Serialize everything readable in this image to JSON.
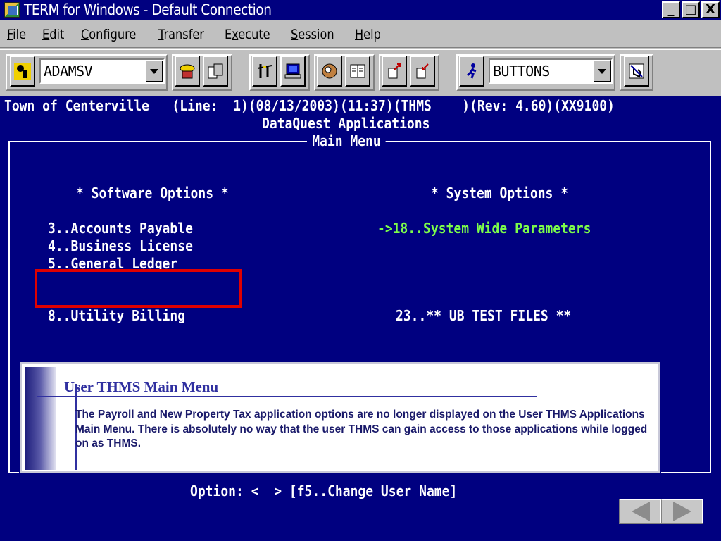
{
  "window": {
    "title": "TERM for Windows - Default Connection",
    "minimize": "_",
    "maximize": "□",
    "close": "X"
  },
  "menu": {
    "items": [
      {
        "first": "F",
        "rest": "ile"
      },
      {
        "first": "E",
        "rest": "dit"
      },
      {
        "first": "C",
        "rest": "onfigure"
      },
      {
        "first": "T",
        "rest": "ransfer"
      },
      {
        "pre": "E",
        "first": "x",
        "rest": "ecute"
      },
      {
        "first": "S",
        "rest": "ession"
      },
      {
        "first": "H",
        "rest": "elp"
      }
    ]
  },
  "toolbar": {
    "connection_value": "ADAMSV",
    "buttons_value": "BUTTONS",
    "icons": [
      "connect-icon",
      "phone-icon",
      "copy-sessions-icon",
      "network-icon",
      "computer-icon",
      "baseball-glove-icon",
      "book-icon",
      "send-file-icon",
      "receive-file-icon",
      "run-icon",
      "hand-icon"
    ]
  },
  "terminal": {
    "status_line": "Town of Centerville   (Line:  1)(08/13/2003)(11:37)(THMS    )(Rev: 4.60)(XX9100)",
    "app_title": "DataQuest Applications",
    "menu_title": "Main Menu",
    "software_header": "* Software Options *",
    "system_header": "* System Options *",
    "software_options": [
      "3..Accounts Payable",
      "4..Business License",
      "5..General Ledger",
      "8..Utility Billing"
    ],
    "system_selected": "->18..System Wide Parameters",
    "system_other": "23..** UB TEST FILES **",
    "prompt": "Option: <  > [f5..Change User Name]"
  },
  "callout": {
    "title": "User THMS Main Menu",
    "body": "The Payroll and New Property Tax application options are no longer displayed on the User THMS Applications Main Menu.   There is absolutely no way that the user THMS can gain access to those applications while logged on as THMS."
  },
  "colors": {
    "terminal_bg": "#000080",
    "highlight_green": "#7cfc4a",
    "highlight_box": "#e00000"
  }
}
